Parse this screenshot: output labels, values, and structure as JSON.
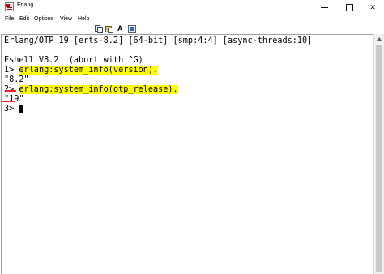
{
  "window": {
    "title": "Erlang",
    "minimize_symbol": "",
    "close_symbol": "✕"
  },
  "menu": [
    "File",
    "Edit",
    "Options",
    "View",
    "Help"
  ],
  "toolbar": {
    "font_label": "A"
  },
  "console": {
    "banner": "Erlang/OTP 19 [erts-8.2] [64-bit] [smp:4:4] [async-threads:10]",
    "shell_version": "Eshell V8.2  (abort with ^G)",
    "prompt1": "1> ",
    "cmd1": "erlang:system_info(version).",
    "out1": "\"8.2\"",
    "prompt2": "2> ",
    "cmd2": "erlang:system_info(otp_release).",
    "out2": "\"19\"",
    "prompt3": "3> "
  },
  "colors": {
    "highlight": "#ffff00",
    "underline": "#ff2020"
  }
}
